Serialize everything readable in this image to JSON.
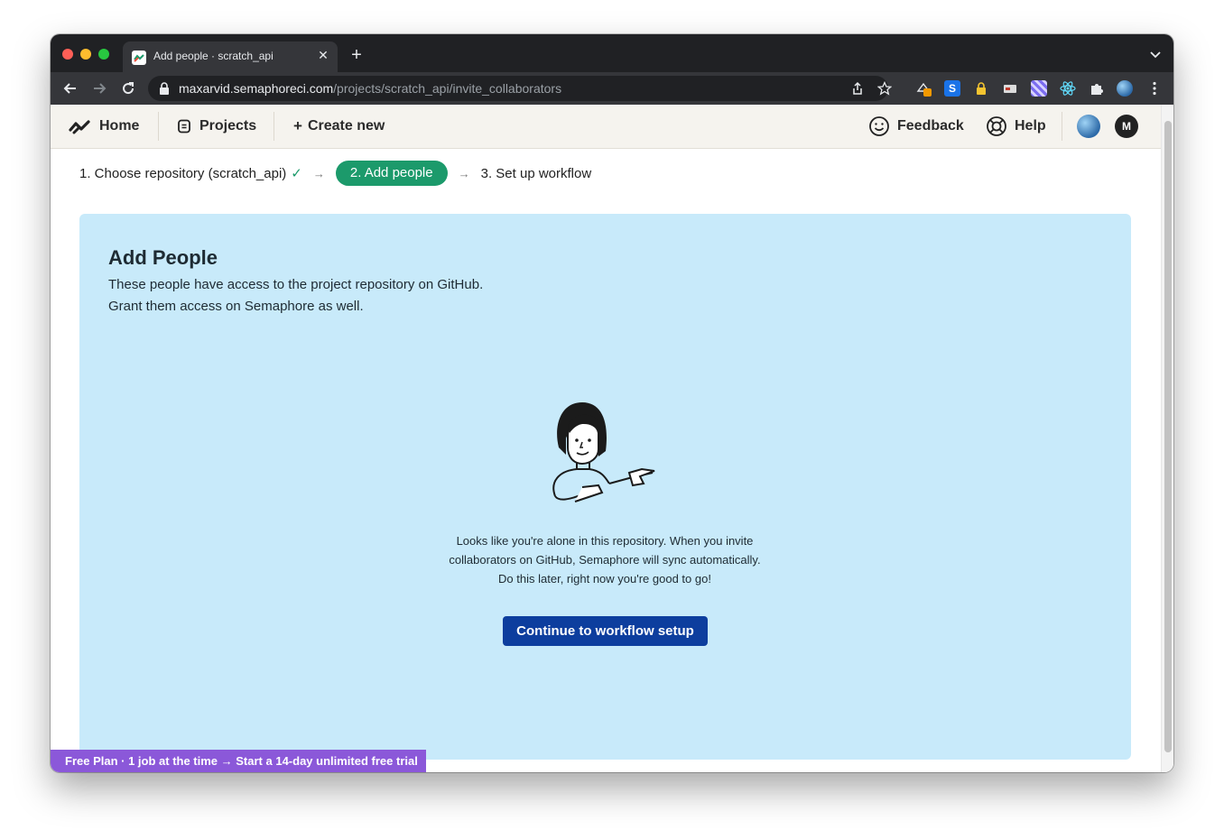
{
  "browser": {
    "tab_title": "Add people · scratch_api",
    "new_tab_label": "+",
    "url_host": "maxarvid.semaphoreci.com",
    "url_path": "/projects/scratch_api/invite_collaborators",
    "extension_badge": "1"
  },
  "nav": {
    "home": "Home",
    "projects": "Projects",
    "create_new": "Create new",
    "feedback": "Feedback",
    "help": "Help",
    "user_initial": "M"
  },
  "steps": {
    "step1": "1. Choose repository (scratch_api)",
    "step1_check": "✓",
    "arrow": "→",
    "step2": "2. Add people",
    "step3": "3. Set up workflow"
  },
  "panel": {
    "title": "Add People",
    "desc_line1": "These people have access to the project repository on GitHub.",
    "desc_line2": "Grant them access on Semaphore as well.",
    "msg_line1": "Looks like you're alone in this repository. When you invite",
    "msg_line2": "collaborators on GitHub, Semaphore will sync automatically.",
    "msg_line3": "Do this later, right now you're good to go!",
    "cta": "Continue to workflow setup"
  },
  "banner": {
    "text": "Free Plan · 1 job at the time → Start a 14-day unlimited free trial"
  },
  "colors": {
    "accent_green": "#1c9a6b",
    "panel_bg": "#c8eafa",
    "cta_blue": "#0d3e9e",
    "banner_purple": "#8b58d9"
  }
}
